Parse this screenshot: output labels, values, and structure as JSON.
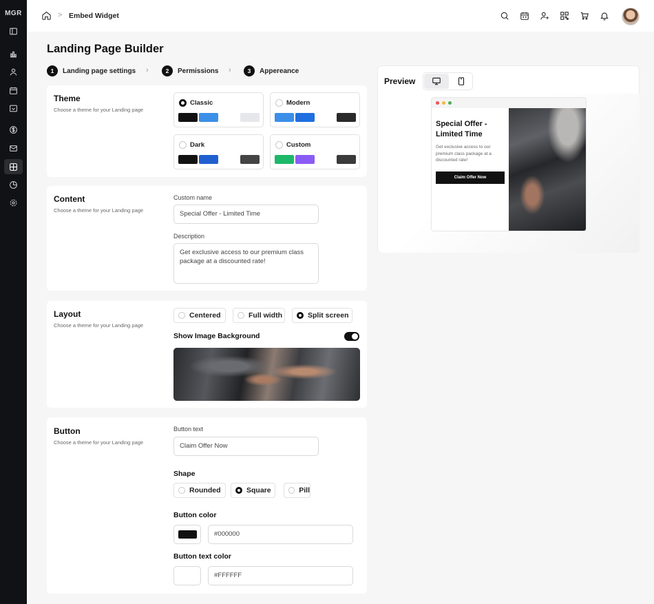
{
  "brand": {
    "logo_text": "MGR"
  },
  "breadcrumb": {
    "current": "Embed Widget",
    "separator": ">"
  },
  "page": {
    "title": "Landing Page Builder"
  },
  "steps": [
    {
      "num": "1",
      "label": "Landing page settings"
    },
    {
      "num": "2",
      "label": "Permissions"
    },
    {
      "num": "3",
      "label": "Appereance"
    }
  ],
  "theme": {
    "title": "Theme",
    "subtitle": "Choose a theme for your Landing page",
    "options": [
      {
        "label": "Classic",
        "selected": true,
        "colors": [
          "#111111",
          "#3b8fe8",
          "#e6e7ea"
        ]
      },
      {
        "label": "Modern",
        "selected": false,
        "colors": [
          "#3b8fe8",
          "#1f6fe0",
          "#2a2a2a"
        ]
      },
      {
        "label": "Dark",
        "selected": false,
        "colors": [
          "#111111",
          "#1f5fcf",
          "#444444"
        ]
      },
      {
        "label": "Custom",
        "selected": false,
        "colors": [
          "#1db86a",
          "#8a5cf5",
          "#3a3a3a"
        ]
      }
    ]
  },
  "content": {
    "title": "Content",
    "subtitle": "Choose a theme for your Landing page",
    "name_label": "Custom name",
    "name_value": "Special Offer - Limited Time",
    "desc_label": "Description",
    "desc_value": "Get exclusive access to our premium class package at a discounted rate!"
  },
  "layout": {
    "title": "Layout",
    "subtitle": "Choose a theme for your Landing page",
    "options": [
      {
        "label": "Centered",
        "selected": false
      },
      {
        "label": "Full width",
        "selected": false
      },
      {
        "label": "Split screen",
        "selected": true
      }
    ],
    "bg_label": "Show Image Background",
    "bg_enabled": true
  },
  "button": {
    "title": "Button",
    "subtitle": "Choose a theme for your Landing page",
    "text_label": "Button text",
    "text_value": "Claim Offer Now",
    "shape_label": "Shape",
    "shapes": [
      {
        "label": "Rounded",
        "selected": false
      },
      {
        "label": "Square",
        "selected": true
      },
      {
        "label": "Pill",
        "selected": false
      }
    ],
    "color_label": "Button color",
    "color_value": "#000000",
    "text_color_label": "Button text color",
    "text_color_value": "#FFFFFF"
  },
  "preview": {
    "title": "Preview",
    "mock_title": "Special Offer - Limited Time",
    "mock_desc": "Get exclusive access to our premium class package at a discounted rate!",
    "mock_button": "Claim Offer Now",
    "dots": [
      "#ef5350",
      "#f5b840",
      "#4caf50"
    ]
  },
  "icons": {
    "sidebar": [
      "panel-icon",
      "chart-icon",
      "user-icon",
      "calendar-icon",
      "inbox-icon",
      "dollar-icon",
      "mail-icon",
      "widget-icon",
      "pie-chart-icon",
      "settings-icon"
    ],
    "topbar": [
      "search-icon",
      "calendar-icon",
      "user-plus-icon",
      "qr-code-icon",
      "cart-icon",
      "bell-icon"
    ]
  }
}
